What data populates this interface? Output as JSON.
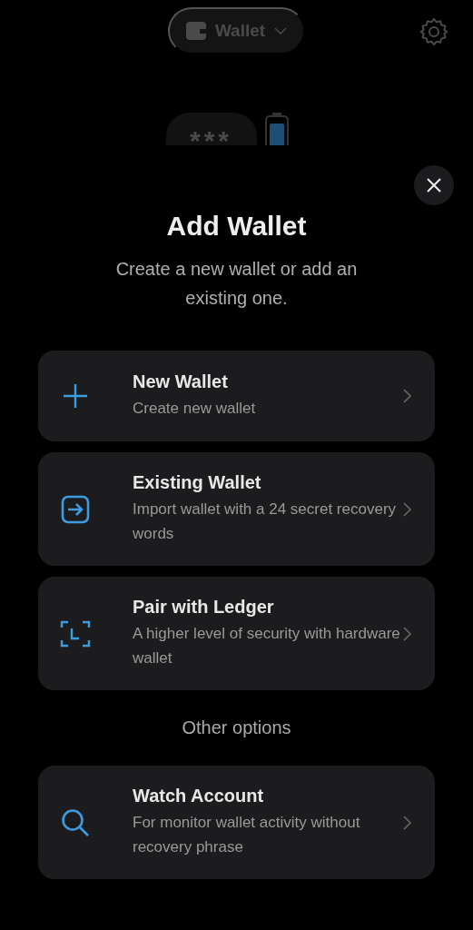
{
  "header": {
    "wallet_label": "Wallet",
    "balance_masked": "***"
  },
  "sheet": {
    "title": "Add Wallet",
    "subtitle": "Create a new wallet or add an existing one.",
    "options": [
      {
        "kind": "plus",
        "title": "New Wallet",
        "description": "Create new wallet"
      },
      {
        "kind": "import",
        "title": "Existing Wallet",
        "description": "Import wallet with a 24 secret recovery words"
      },
      {
        "kind": "scan",
        "title": "Pair with Ledger",
        "description": "A higher level of security with hardware wallet"
      }
    ],
    "section_label": "Other options",
    "other_options": [
      {
        "kind": "search",
        "title": "Watch Account",
        "description": "For monitor wallet activity without recovery phrase"
      }
    ]
  }
}
